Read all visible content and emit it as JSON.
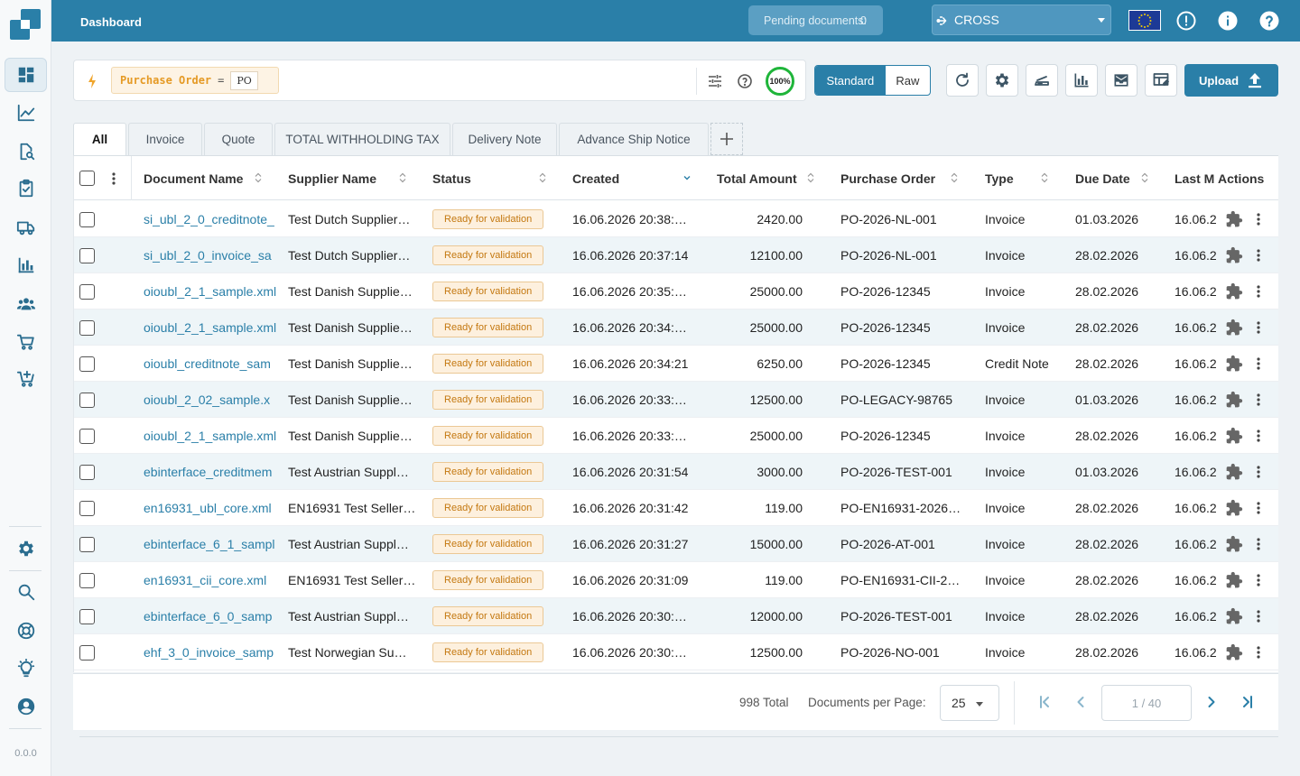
{
  "app": {
    "title": "Dashboard",
    "version": "0.0.0"
  },
  "topbar": {
    "pending_label": "Pending documents:",
    "pending_count": "0",
    "tenant": "CROSS"
  },
  "filter": {
    "field": "Purchase Order",
    "operator": "=",
    "value": "PO",
    "score": "100%"
  },
  "view_toggle": {
    "standard": "Standard",
    "raw": "Raw"
  },
  "upload_label": "Upload",
  "tabs": [
    "All",
    "Invoice",
    "Quote",
    "TOTAL WITHHOLDING TAX",
    "Delivery Note",
    "Advance Ship Notice"
  ],
  "columns": {
    "document_name": "Document Name",
    "supplier_name": "Supplier Name",
    "status": "Status",
    "created": "Created",
    "total_amount": "Total Amount",
    "purchase_order": "Purchase Order",
    "type": "Type",
    "due_date": "Due Date",
    "last_modified": "Last M",
    "actions": "Actions"
  },
  "rows": [
    {
      "name": "si_ubl_2_0_creditnote_",
      "supplier": "Test Dutch Supplier…",
      "status": "Ready for validation",
      "created": "16.06.2026 20:38:…",
      "amount": "2420.00",
      "po": "PO-2026-NL-001",
      "type": "Invoice",
      "due": "01.03.2026",
      "modified": "16.06.2"
    },
    {
      "name": "si_ubl_2_0_invoice_sa",
      "supplier": "Test Dutch Supplier…",
      "status": "Ready for validation",
      "created": "16.06.2026 20:37:14",
      "amount": "12100.00",
      "po": "PO-2026-NL-001",
      "type": "Invoice",
      "due": "28.02.2026",
      "modified": "16.06.2"
    },
    {
      "name": "oioubl_2_1_sample.xml",
      "supplier": "Test Danish Supplie…",
      "status": "Ready for validation",
      "created": "16.06.2026 20:35:…",
      "amount": "25000.00",
      "po": "PO-2026-12345",
      "type": "Invoice",
      "due": "28.02.2026",
      "modified": "16.06.2"
    },
    {
      "name": "oioubl_2_1_sample.xml",
      "supplier": "Test Danish Supplie…",
      "status": "Ready for validation",
      "created": "16.06.2026 20:34:…",
      "amount": "25000.00",
      "po": "PO-2026-12345",
      "type": "Invoice",
      "due": "28.02.2026",
      "modified": "16.06.2"
    },
    {
      "name": "oioubl_creditnote_sam",
      "supplier": "Test Danish Supplie…",
      "status": "Ready for validation",
      "created": "16.06.2026 20:34:21",
      "amount": "6250.00",
      "po": "PO-2026-12345",
      "type": "Credit Note",
      "due": "28.02.2026",
      "modified": "16.06.2"
    },
    {
      "name": "oioubl_2_02_sample.x",
      "supplier": "Test Danish Supplie…",
      "status": "Ready for validation",
      "created": "16.06.2026 20:33:…",
      "amount": "12500.00",
      "po": "PO-LEGACY-98765",
      "type": "Invoice",
      "due": "01.03.2026",
      "modified": "16.06.2"
    },
    {
      "name": "oioubl_2_1_sample.xml",
      "supplier": "Test Danish Supplie…",
      "status": "Ready for validation",
      "created": "16.06.2026 20:33:…",
      "amount": "25000.00",
      "po": "PO-2026-12345",
      "type": "Invoice",
      "due": "28.02.2026",
      "modified": "16.06.2"
    },
    {
      "name": "ebinterface_creditmem",
      "supplier": "Test Austrian Suppl…",
      "status": "Ready for validation",
      "created": "16.06.2026 20:31:54",
      "amount": "3000.00",
      "po": "PO-2026-TEST-001",
      "type": "Invoice",
      "due": "01.03.2026",
      "modified": "16.06.2"
    },
    {
      "name": "en16931_ubl_core.xml",
      "supplier": "EN16931 Test Seller…",
      "status": "Ready for validation",
      "created": "16.06.2026 20:31:42",
      "amount": "119.00",
      "po": "PO-EN16931-2026…",
      "type": "Invoice",
      "due": "28.02.2026",
      "modified": "16.06.2"
    },
    {
      "name": "ebinterface_6_1_sampl",
      "supplier": "Test Austrian Suppl…",
      "status": "Ready for validation",
      "created": "16.06.2026 20:31:27",
      "amount": "15000.00",
      "po": "PO-2026-AT-001",
      "type": "Invoice",
      "due": "28.02.2026",
      "modified": "16.06.2"
    },
    {
      "name": "en16931_cii_core.xml",
      "supplier": "EN16931 Test Seller…",
      "status": "Ready for validation",
      "created": "16.06.2026 20:31:09",
      "amount": "119.00",
      "po": "PO-EN16931-CII-2…",
      "type": "Invoice",
      "due": "28.02.2026",
      "modified": "16.06.2"
    },
    {
      "name": "ebinterface_6_0_samp",
      "supplier": "Test Austrian Suppl…",
      "status": "Ready for validation",
      "created": "16.06.2026 20:30:…",
      "amount": "12000.00",
      "po": "PO-2026-TEST-001",
      "type": "Invoice",
      "due": "28.02.2026",
      "modified": "16.06.2"
    },
    {
      "name": "ehf_3_0_invoice_samp",
      "supplier": "Test Norwegian Su…",
      "status": "Ready for validation",
      "created": "16.06.2026 20:30:…",
      "amount": "12500.00",
      "po": "PO-2026-NO-001",
      "type": "Invoice",
      "due": "28.02.2026",
      "modified": "16.06.2"
    }
  ],
  "footer": {
    "total": "998 Total",
    "per_page_label": "Documents per Page:",
    "per_page": "25",
    "page": "1 / 40"
  },
  "colors": {
    "primary": "#2a7fa8",
    "badge_text": "#c47810",
    "badge_bg": "#fdf0de",
    "score_ring": "#1fb53a"
  }
}
